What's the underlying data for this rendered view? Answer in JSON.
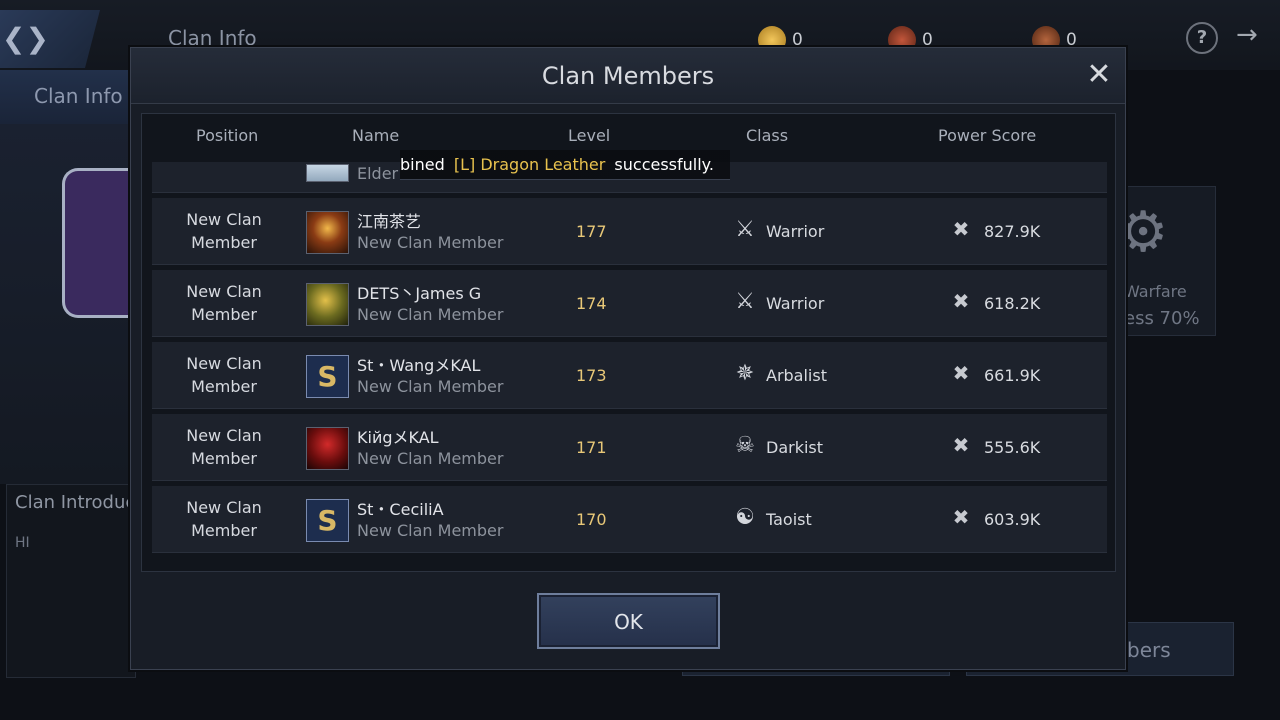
{
  "background": {
    "title": "Clan Info",
    "tab": "Clan Info",
    "currencies": [
      "0",
      "0",
      "0"
    ],
    "help_label": "?",
    "intro_title": "Clan Introduc",
    "intro_text": "HI",
    "right_panel": {
      "label": "Warfare",
      "progress": "ess 70%"
    },
    "members_button": "bers"
  },
  "modal": {
    "title": "Clan Members",
    "columns": [
      "Position",
      "Name",
      "Level",
      "Class",
      "Power Score"
    ],
    "toast": {
      "prefix": "bined",
      "item": "[L] Dragon Leather",
      "suffix": "successfully."
    },
    "partial_row": {
      "rank": "Elder"
    },
    "members": [
      {
        "position_line1": "New Clan",
        "position_line2": "Member",
        "name": "江南茶艺",
        "rank": "New Clan Member",
        "level": "177",
        "class": "Warrior",
        "power": "827.9K"
      },
      {
        "position_line1": "New Clan",
        "position_line2": "Member",
        "name": "DETS丶James G",
        "rank": "New Clan Member",
        "level": "174",
        "class": "Warrior",
        "power": "618.2K"
      },
      {
        "position_line1": "New Clan",
        "position_line2": "Member",
        "name": "St・WangメKAL",
        "rank": "New Clan Member",
        "level": "173",
        "class": "Arbalist",
        "power": "661.9K"
      },
      {
        "position_line1": "New Clan",
        "position_line2": "Member",
        "name": "KiйgメKAL",
        "rank": "New Clan Member",
        "level": "171",
        "class": "Darkist",
        "power": "555.6K"
      },
      {
        "position_line1": "New Clan",
        "position_line2": "Member",
        "name": "St・CeciliA",
        "rank": "New Clan Member",
        "level": "170",
        "class": "Taoist",
        "power": "603.9K"
      }
    ],
    "ok_label": "OK"
  }
}
